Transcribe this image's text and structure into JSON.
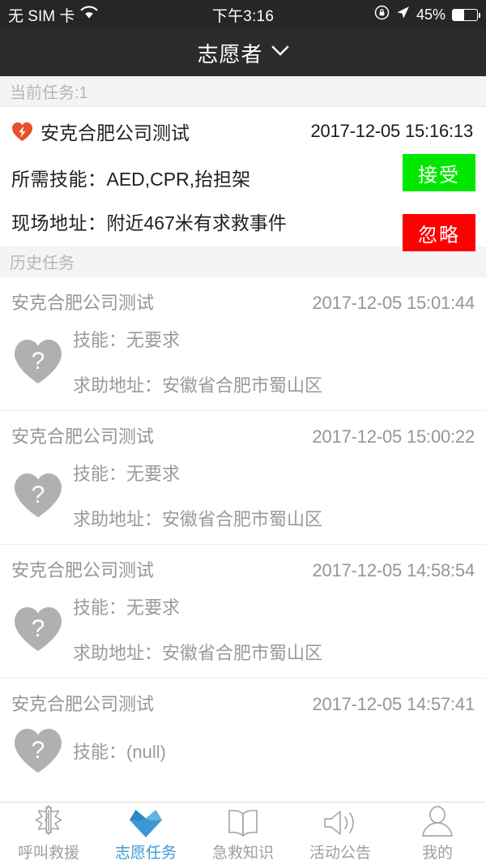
{
  "status_bar": {
    "carrier": "无 SIM 卡",
    "wifi_icon": "wifi-icon",
    "time": "下午3:16",
    "rotation_lock_icon": "rotation-lock-icon",
    "location_icon": "location-arrow-icon",
    "battery_percent": "45%",
    "battery_level": 45
  },
  "header": {
    "title": "志愿者",
    "chevron_icon": "chevron-down-icon"
  },
  "current_section": {
    "band_label": "当前任务:1",
    "task": {
      "alert_icon": "heart-lightning-icon",
      "title": "安克合肥公司测试",
      "time": "2017-12-05 15:16:13",
      "skill_label": "所需技能：",
      "skill_value": "AED,CPR,抬担架",
      "address_label": "现场地址：",
      "address_value": "附近467米有求救事件",
      "accept_label": "接受",
      "ignore_label": "忽略",
      "accept_color": "#00e800",
      "ignore_color": "#ff0000"
    }
  },
  "history_section": {
    "band_label": "历史任务",
    "items": [
      {
        "icon": "heart-question-icon",
        "title": "安克合肥公司测试",
        "time": "2017-12-05 15:01:44",
        "skill_label": "技能：",
        "skill_value": "无要求",
        "address_label": "求助地址：",
        "address_value": "安徽省合肥市蜀山区"
      },
      {
        "icon": "heart-question-icon",
        "title": "安克合肥公司测试",
        "time": "2017-12-05 15:00:22",
        "skill_label": "技能：",
        "skill_value": "无要求",
        "address_label": "求助地址：",
        "address_value": "安徽省合肥市蜀山区"
      },
      {
        "icon": "heart-question-icon",
        "title": "安克合肥公司测试",
        "time": "2017-12-05 14:58:54",
        "skill_label": "技能：",
        "skill_value": "无要求",
        "address_label": "求助地址：",
        "address_value": "安徽省合肥市蜀山区"
      },
      {
        "icon": "heart-question-icon",
        "title": "安克合肥公司测试",
        "time": "2017-12-05 14:57:41",
        "skill_label": "技能：",
        "skill_value": "(null)",
        "address_label": "",
        "address_value": ""
      }
    ]
  },
  "tabbar": {
    "active_color": "#3c97d3",
    "inactive_color": "#9e9e9e",
    "items": [
      {
        "icon": "star-of-life-icon",
        "label": "呼叫救援",
        "active": false
      },
      {
        "icon": "blue-heart-icon",
        "label": "志愿任务",
        "active": true
      },
      {
        "icon": "open-book-icon",
        "label": "急救知识",
        "active": false
      },
      {
        "icon": "speaker-icon",
        "label": "活动公告",
        "active": false
      },
      {
        "icon": "person-icon",
        "label": "我的",
        "active": false
      }
    ]
  }
}
